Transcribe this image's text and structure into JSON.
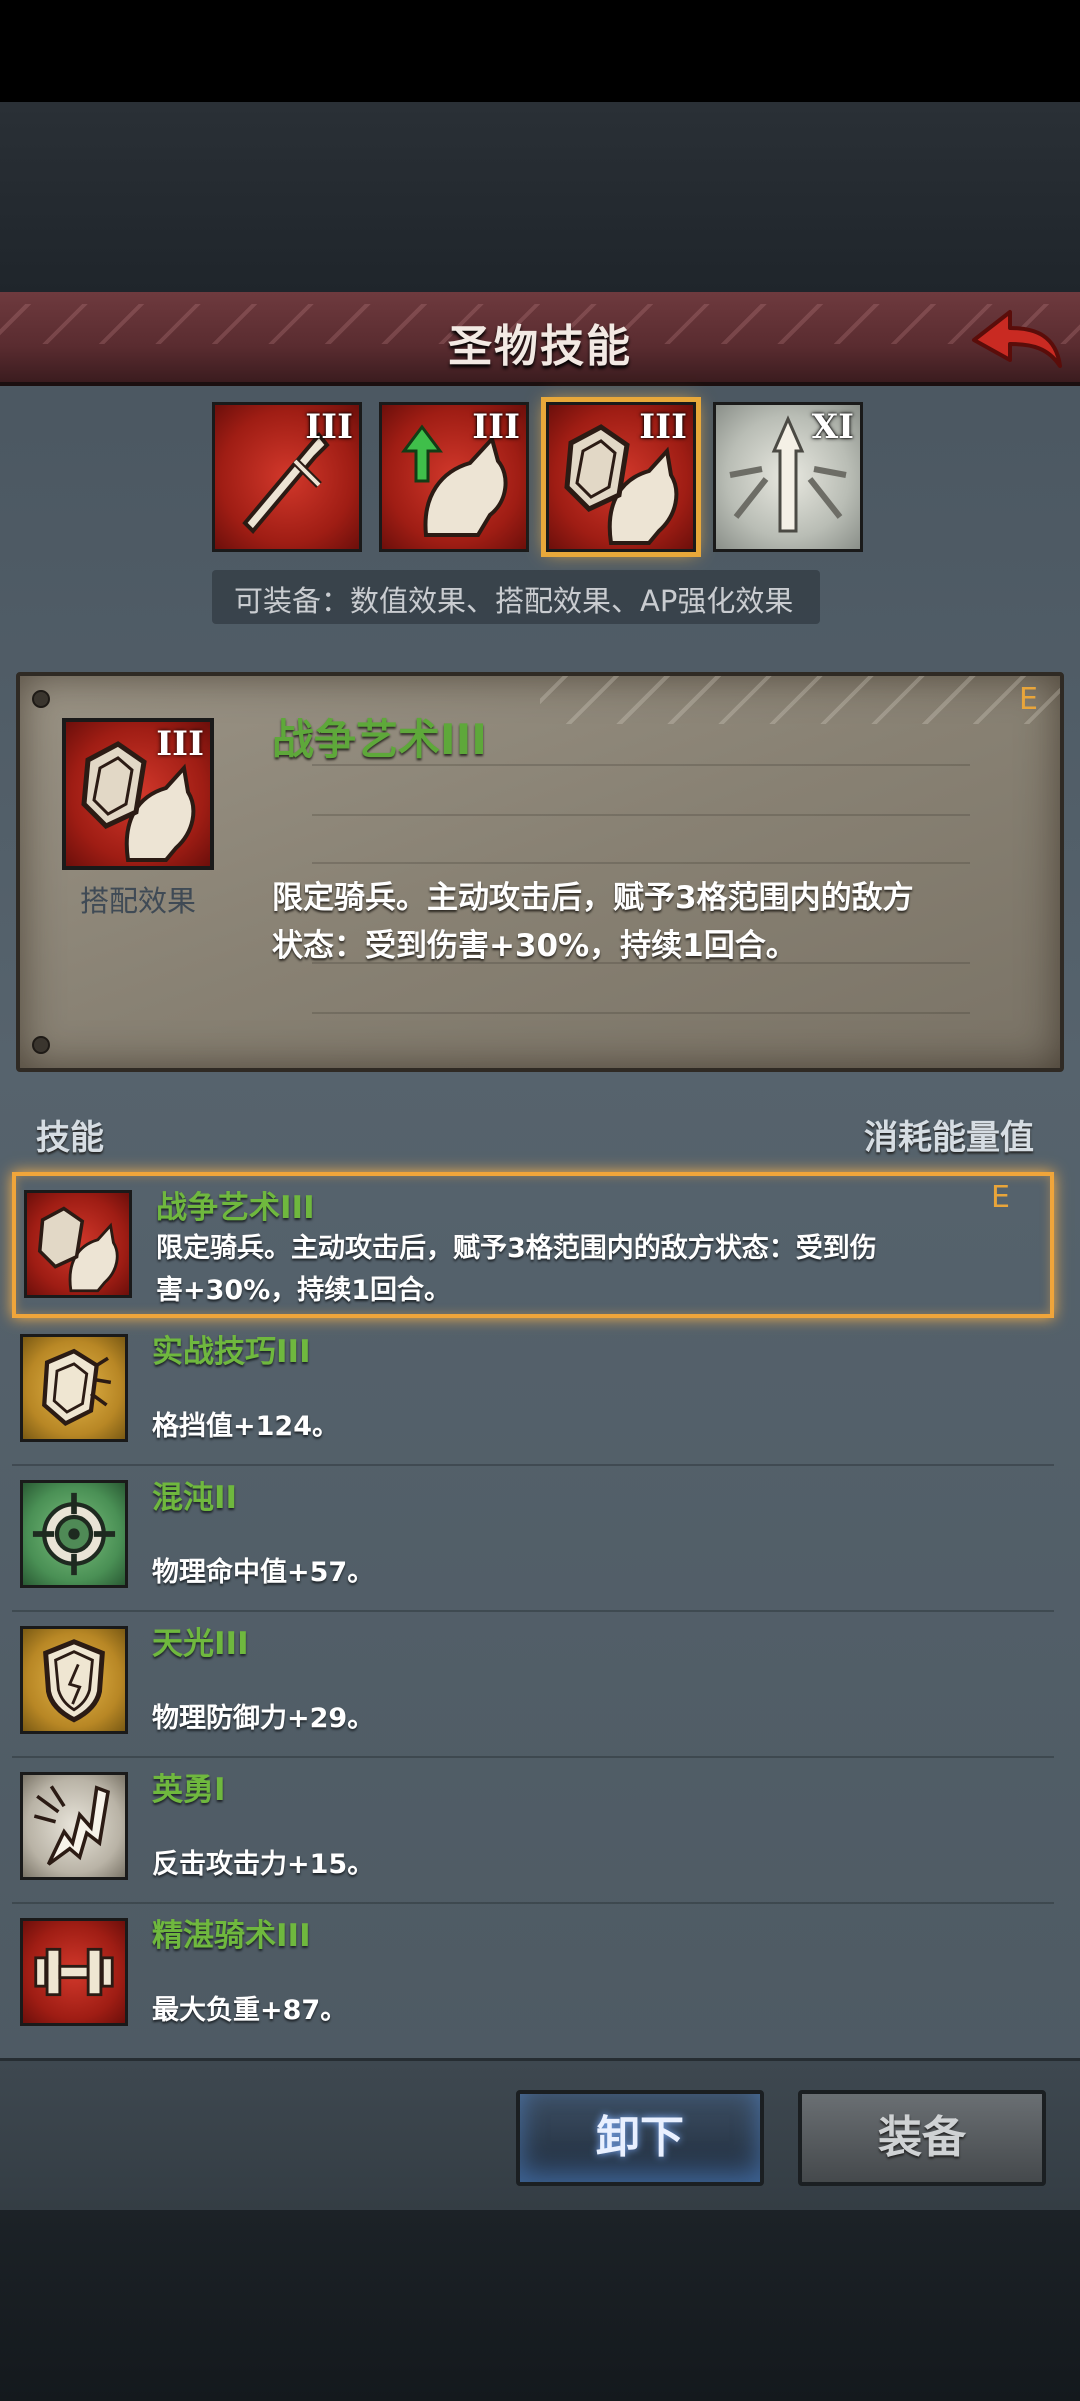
{
  "header": {
    "title": "圣物技能"
  },
  "slots": [
    {
      "roman": "III",
      "icon": "sword-icon",
      "color": "#c02a1f"
    },
    {
      "roman": "III",
      "icon": "cavalry-upgrade-icon",
      "color": "#c02a1f"
    },
    {
      "roman": "III",
      "icon": "shield-horse-icon",
      "color": "#c02a1f",
      "selected": true
    },
    {
      "roman": "XI",
      "icon": "spear-burst-icon",
      "color": "#c8cbc4"
    }
  ],
  "equip_note": "可装备：数值效果、搭配效果、AP强化效果",
  "detail": {
    "grade": "E",
    "roman": "III",
    "icon_label": "搭配效果",
    "name": "战争艺术III",
    "desc_line1": "限定骑兵。主动攻击后，赋予3格范围内的敌方",
    "desc_line2": "状态：受到伤害+30%，持续1回合。"
  },
  "list_header": {
    "left": "技能",
    "right": "消耗能量值"
  },
  "skills": [
    {
      "name": "战争艺术III",
      "desc_line1": "限定骑兵。主动攻击后，赋予3格范围内的敌方状态：受到伤",
      "desc_line2": "害+30%，持续1回合。",
      "grade": "E",
      "icon": "shield-horse-icon",
      "selected": true
    },
    {
      "name": "实战技巧III",
      "desc": "格挡值+124。",
      "icon": "shield-crack-icon"
    },
    {
      "name": "混沌II",
      "desc": "物理命中值+57。",
      "icon": "crosshair-icon"
    },
    {
      "name": "天光III",
      "desc": "物理防御力+29。",
      "icon": "shield-icon"
    },
    {
      "name": "英勇I",
      "desc": "反击攻击力+15。",
      "icon": "counter-strike-icon"
    },
    {
      "name": "精湛骑术III",
      "desc": "最大负重+87。",
      "icon": "dumbbell-icon"
    }
  ],
  "buttons": {
    "unequip": "卸下",
    "equip": "装备"
  },
  "colors": {
    "accent_gold": "#e9a53a",
    "skill_name_green": "#6fb83e",
    "title_bar": "#5a2c30"
  }
}
